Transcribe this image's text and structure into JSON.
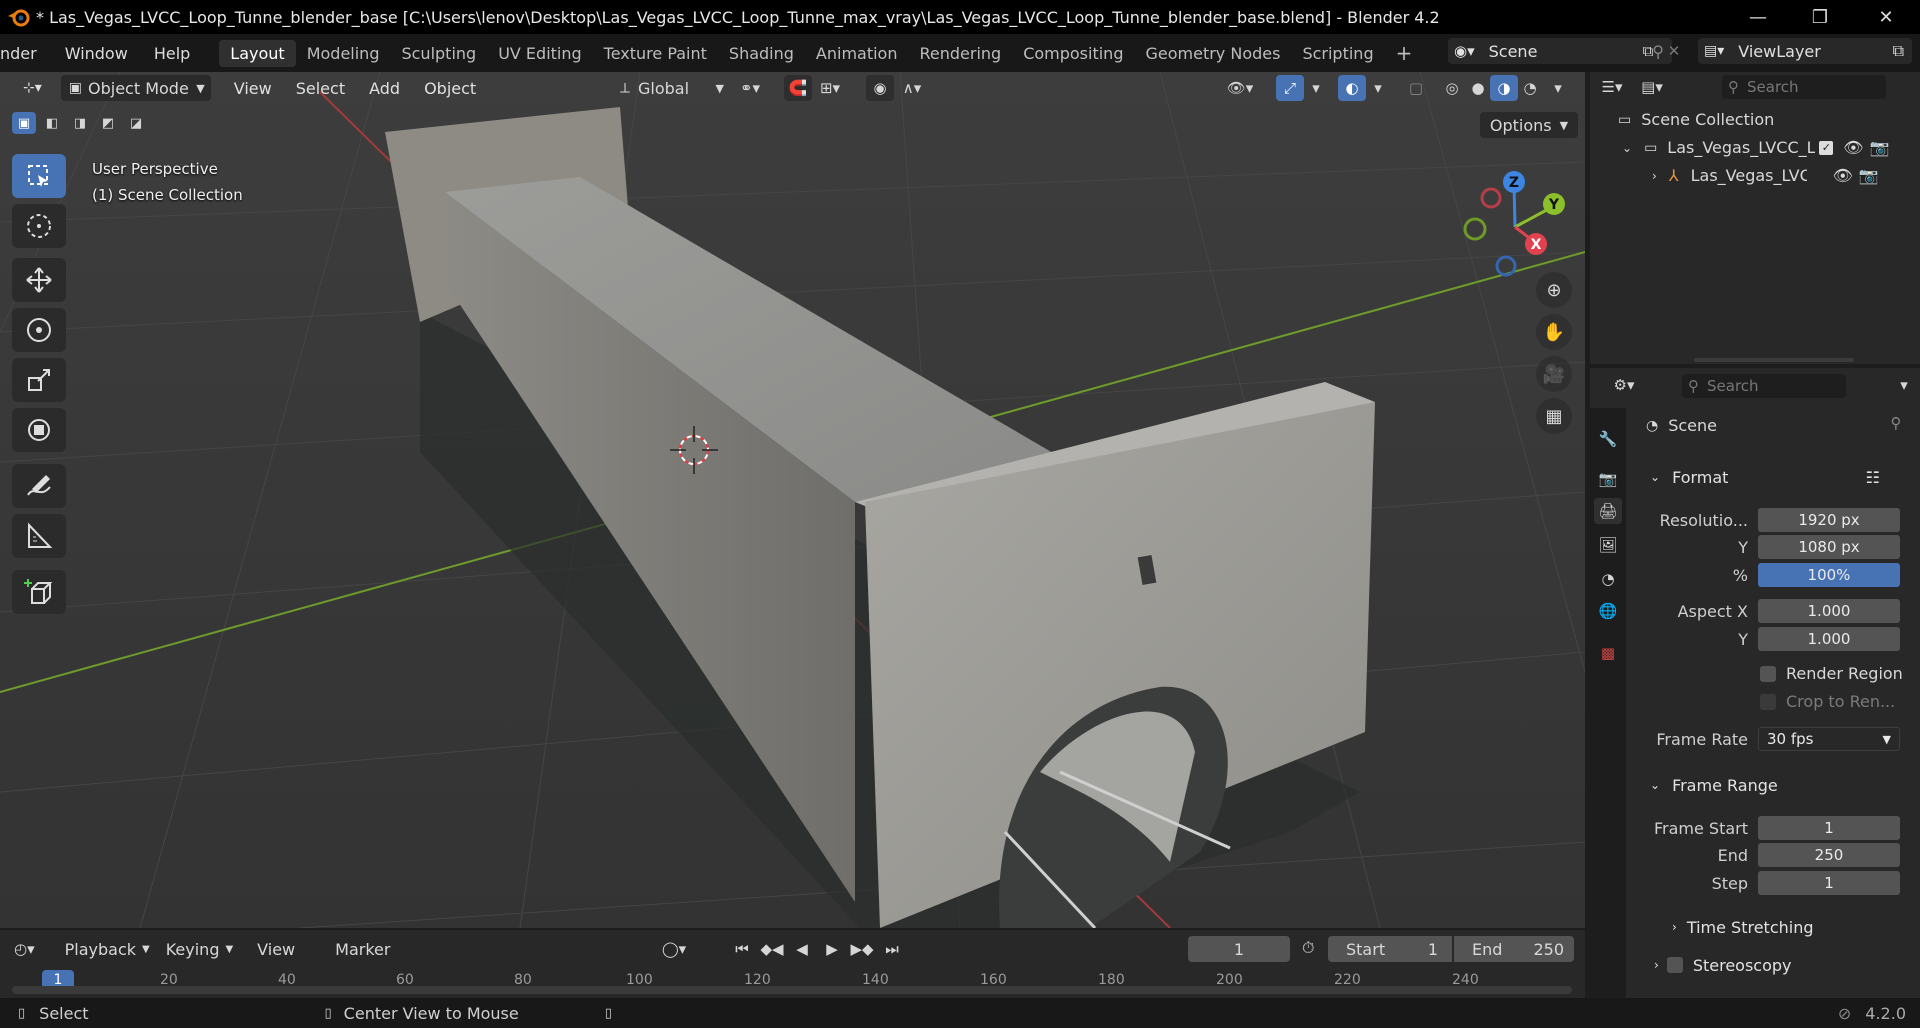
{
  "window": {
    "title": "* Las_Vegas_LVCC_Loop_Tunne_blender_base [C:\\Users\\lenov\\Desktop\\Las_Vegas_LVCC_Loop_Tunne_max_vray\\Las_Vegas_LVCC_Loop_Tunne_blender_base.blend] - Blender 4.2",
    "controls": [
      "—",
      "❐",
      "✕"
    ]
  },
  "menubar": {
    "items": [
      "nder",
      "Window",
      "Help"
    ],
    "workspaces": [
      "Layout",
      "Modeling",
      "Sculpting",
      "UV Editing",
      "Texture Paint",
      "Shading",
      "Animation",
      "Rendering",
      "Compositing",
      "Geometry Nodes",
      "Scripting"
    ],
    "add_tab": "+",
    "scene_name": "Scene",
    "view_layer": "ViewLayer"
  },
  "viewport": {
    "mode": "Object Mode",
    "menus": [
      "View",
      "Select",
      "Add",
      "Object"
    ],
    "orientation": "Global",
    "options_label": "Options",
    "overlay_line1": "User Perspective",
    "overlay_line2": "(1) Scene Collection",
    "gizmo_axes": {
      "x": "X",
      "y": "Y",
      "z": "Z"
    }
  },
  "outliner": {
    "search_placeholder": "Search",
    "root": "Scene Collection",
    "collection": "Las_Vegas_LVCC_L",
    "object": "Las_Vegas_LVC"
  },
  "properties": {
    "search_placeholder": "Search",
    "context": "Scene",
    "format_header": "Format",
    "resolution_label": "Resolutio...",
    "res_x": "1920 px",
    "y_label": "Y",
    "res_y": "1080 px",
    "pct_label": "%",
    "res_pct": "100%",
    "aspect_x_label": "Aspect X",
    "aspect_x": "1.000",
    "aspect_y_label": "Y",
    "aspect_y": "1.000",
    "render_region": "Render Region",
    "crop": "Crop to Ren...",
    "frame_rate_label": "Frame Rate",
    "frame_rate": "30 fps",
    "frame_range_header": "Frame Range",
    "frame_start_label": "Frame Start",
    "frame_start": "1",
    "end_label": "End",
    "frame_end": "250",
    "step_label": "Step",
    "frame_step": "1",
    "time_stretching": "Time Stretching",
    "stereoscopy": "Stereoscopy"
  },
  "timeline": {
    "menus": [
      "Playback",
      "Keying",
      "View",
      "Marker"
    ],
    "current_frame": "1",
    "start_label": "Start",
    "start": "1",
    "end_label": "End",
    "end": "250",
    "playhead": "1",
    "ticks": [
      "20",
      "40",
      "60",
      "80",
      "100",
      "120",
      "140",
      "160",
      "180",
      "200",
      "220",
      "240"
    ]
  },
  "statusbar": {
    "select": "Select",
    "center_view": "Center View to Mouse",
    "version": "4.2.0"
  },
  "colors": {
    "accent": "#4772b3",
    "x_axis": "#e0424f",
    "y_axis": "#8bbf2c",
    "z_axis": "#3d85e0"
  }
}
